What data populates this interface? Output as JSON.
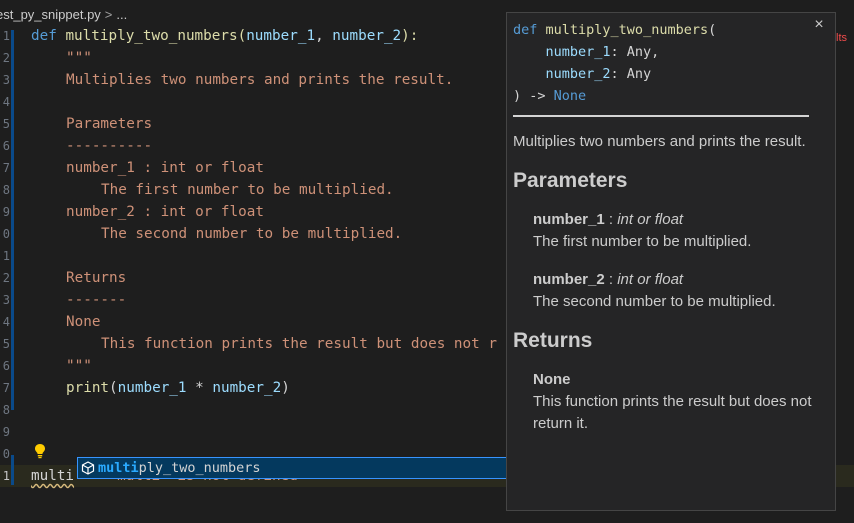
{
  "breadcrumb": {
    "file": "est_py_snippet.py",
    "separator": ">",
    "more": "..."
  },
  "line_numbers": [
    "1",
    "2",
    "3",
    "4",
    "5",
    "6",
    "7",
    "8",
    "9",
    "0",
    "1",
    "2",
    "3",
    "4",
    "5",
    "6",
    "7",
    "8",
    "9",
    "0",
    "1"
  ],
  "code": {
    "l1_def": "def",
    "l1_fn": "multiply_two_numbers",
    "l1_open": "(",
    "l1_p1": "number_1",
    "l1_comma": ", ",
    "l1_p2": "number_2",
    "l1_close": "):",
    "l2": "\"\"\"",
    "l3": "Multiplies two numbers and prints the result.",
    "l5": "Parameters",
    "l6": "----------",
    "l7": "number_1 : int or float",
    "l8": "The first number to be multiplied.",
    "l9": "number_2 : int or float",
    "l10": "The second number to be multiplied.",
    "l12": "Returns",
    "l13": "-------",
    "l14": "None",
    "l15": "This function prints the result but does not r",
    "l16": "\"\"\"",
    "l17_fn": "print",
    "l17_open": "(",
    "l17_p1": "number_1",
    "l17_op": " * ",
    "l17_p2": "number_2",
    "l17_close": ")",
    "typed": "multi",
    "error": "\"multi\" is not defined"
  },
  "suggestion": {
    "match": "multi",
    "rest": "ply_two_numbers",
    "icon": "cube-icon"
  },
  "hover": {
    "sig_def": "def",
    "sig_fn": "multiply_two_numbers",
    "sig_open": "(",
    "sig_p1": "number_1",
    "sig_p1_type": ": Any,",
    "sig_p2": "number_2",
    "sig_p2_type": ": Any",
    "sig_ret": ") -> ",
    "sig_none": "None",
    "close": "×",
    "summary": "Multiplies two numbers and prints the result.",
    "params_heading": "Parameters",
    "p1_name": "number_1",
    "p1_type": "int or float",
    "p1_desc": "The first number to be multiplied.",
    "p2_name": "number_2",
    "p2_type": "int or float",
    "p2_desc": "The second number to be multiplied.",
    "returns_heading": "Returns",
    "ret_name": "None",
    "ret_desc": "This function prints the result but does not return it."
  },
  "right_hint": "lts"
}
